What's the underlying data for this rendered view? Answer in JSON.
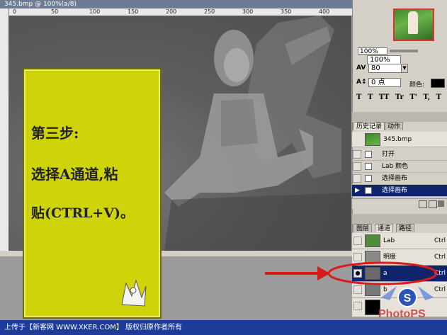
{
  "document": {
    "title": "345.bmp @ 100%(a/8)",
    "ruler_marks": [
      "0",
      "50",
      "100",
      "150",
      "200",
      "250",
      "300",
      "350",
      "400"
    ]
  },
  "note": {
    "line1": "第三步:",
    "line2": "选择A通道,粘",
    "line3": "贴(CTRL+V)。"
  },
  "navigator": {
    "zoom": "100%"
  },
  "character": {
    "leading": "100%",
    "tracking": "80",
    "baseline": "0 点",
    "color_label": "颜色:",
    "style_buttons": [
      "T",
      "T",
      "TT",
      "Tr",
      "T'",
      "T,",
      "T"
    ]
  },
  "history": {
    "tabs": [
      "历史记录",
      "动作"
    ],
    "snapshot": "345.bmp",
    "items": [
      "打开",
      "Lab 颜色",
      "选择画布",
      "选择画布"
    ],
    "selected_index": 3
  },
  "channels": {
    "tabs": [
      "图层",
      "通道",
      "路径"
    ],
    "rows": [
      {
        "name": "Lab",
        "shortcut": "Ctrl",
        "thumb_color": "#4d8d3b"
      },
      {
        "name": "明度",
        "shortcut": "Ctrl",
        "thumb_color": "#8a8a8a"
      },
      {
        "name": "a",
        "shortcut": "Ctrl",
        "thumb_color": "#6a6a6a"
      },
      {
        "name": "b",
        "shortcut": "Ctrl",
        "thumb_color": "#7a7a7a"
      },
      {
        "name": "",
        "shortcut": "",
        "thumb_color": "#000000"
      }
    ],
    "selected_index": 2
  },
  "footer": {
    "text": "上传于【新客网 WWW.XKER.COM】 版权归原作者所有"
  },
  "watermark": {
    "text": "PhotoPS"
  },
  "colors": {
    "note_yellow": "#cfd40a",
    "selection_blue": "#10246a",
    "footer_blue": "#1d3c9a",
    "annotation_red": "#d81c1c"
  }
}
